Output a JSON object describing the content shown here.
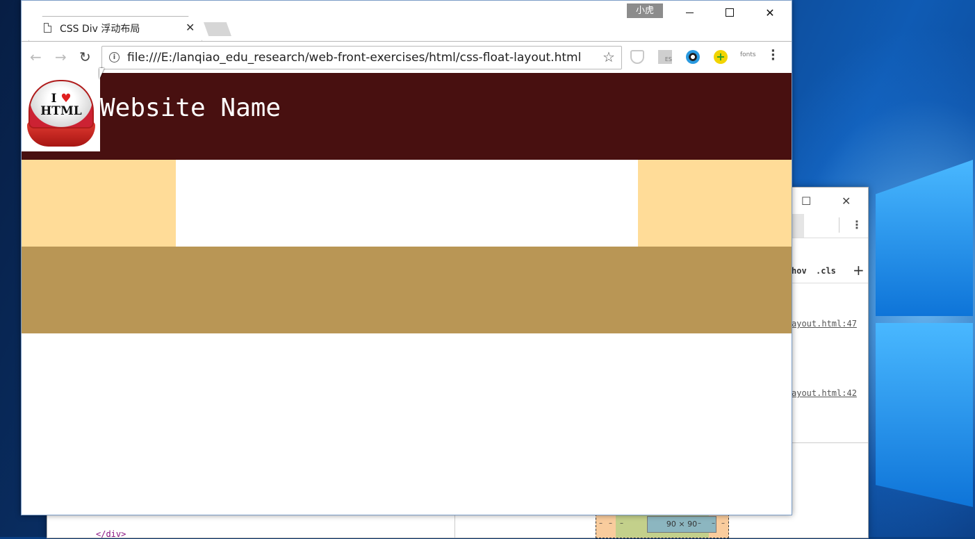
{
  "browser": {
    "tab_title": "CSS Div 浮动布局",
    "url": "file:///E:/lanqiao_edu_research/web-front-exercises/html/css-float-layout.html",
    "user_badge": "小虎",
    "extension_fonts_label": "fonts",
    "extension_es_label": "ES"
  },
  "page": {
    "site_title": "Website Name",
    "logo_text_line1": "I ♥",
    "logo_text_line2": "HTML",
    "colors": {
      "header": "#481010",
      "side_columns": "#ffdc98",
      "main_column": "#ffffff",
      "footer": "#b99655"
    }
  },
  "devtools": {
    "hov": "hov",
    "cls": ".cls",
    "plus": "+",
    "link1": "ayout.html:47",
    "link2": "ayout.html:42",
    "code_line": "</div>",
    "box_content": "90 × 90",
    "box_dash": "–"
  }
}
